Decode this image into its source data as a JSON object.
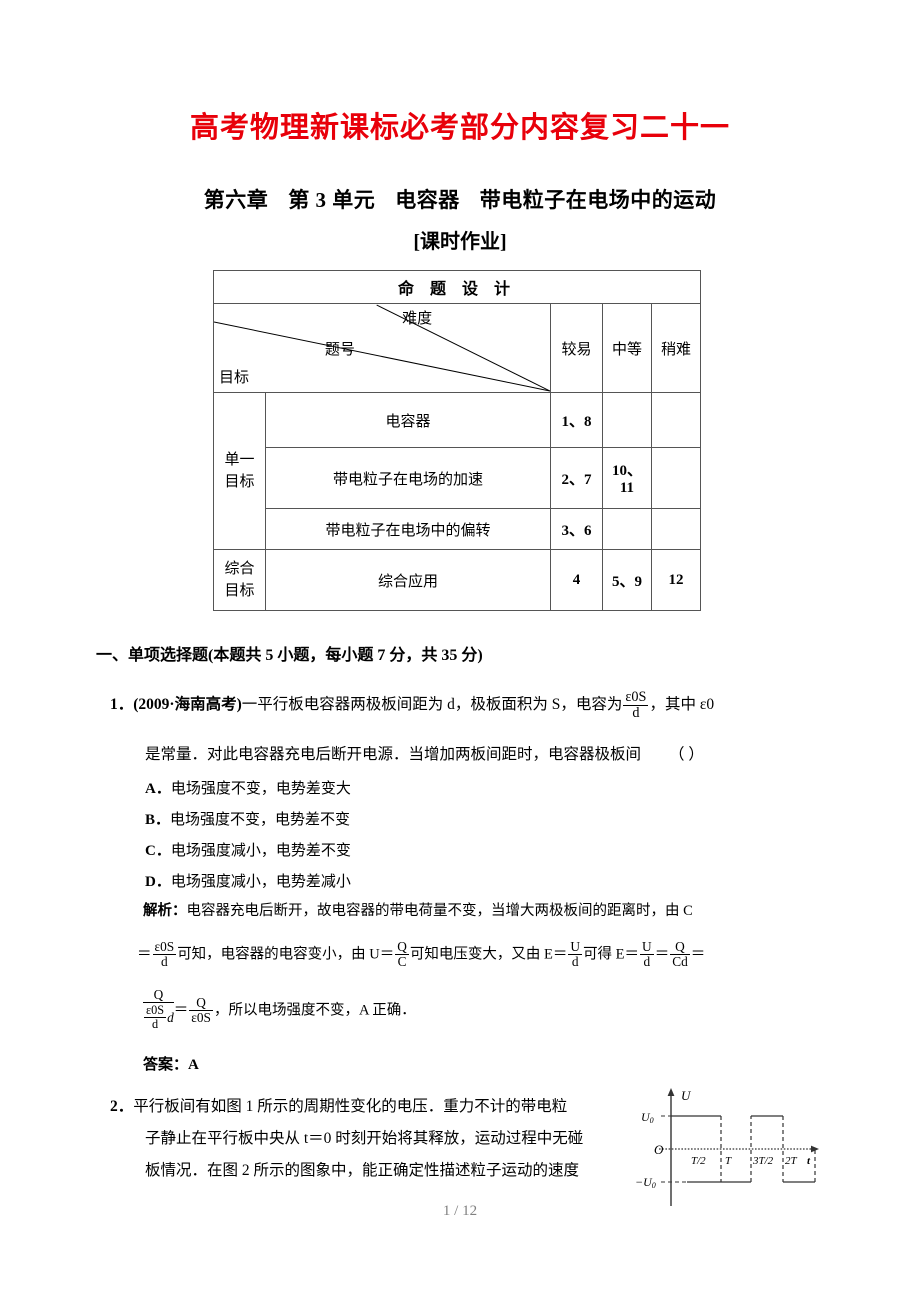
{
  "document": {
    "title": "高考物理新课标必考部分内容复习二十一",
    "title_color": "#e8000a",
    "subtitle_chapter": "第六章",
    "subtitle_unit": "第 3 单元",
    "subtitle_topic1": "电容器",
    "subtitle_topic2": "带电粒子在电场中的运动",
    "bracket_title": "[课时作业]",
    "page_number": "1 / 12"
  },
  "design_table": {
    "caption": "命 题 设 计",
    "header_difficulty": "难度",
    "header_question_no": "题号",
    "header_goal": "目标",
    "difficulty_columns": [
      "较易",
      "中等",
      "稍难"
    ],
    "groups": [
      {
        "label": "单一\n目标",
        "label_line1": "单一",
        "label_line2": "目标",
        "rows": [
          {
            "topic": "电容器",
            "easy": "1、8",
            "medium": "",
            "hard": ""
          },
          {
            "topic": "带电粒子在电场的加速",
            "easy": "2、7",
            "medium": "10、\n11",
            "medium_line1": "10、",
            "medium_line2": "11",
            "hard": ""
          },
          {
            "topic": "带电粒子在电场中的偏转",
            "easy": "3、6",
            "medium": "",
            "hard": ""
          }
        ]
      },
      {
        "label_line1": "综合",
        "label_line2": "目标",
        "rows": [
          {
            "topic": "综合应用",
            "easy": "4",
            "medium": "5、9",
            "hard": "12"
          }
        ]
      }
    ]
  },
  "section": {
    "heading_prefix": "一、单项选择题",
    "heading_detail": "(本题共 5 小题，每小题 7 分，共 35 分)"
  },
  "question1": {
    "number": "1．",
    "source": "(2009·海南高考)",
    "stem_part1": "一平行板电容器两极板间距为 d，极板面积为 S，电容为",
    "formula_numerator": "ε0S",
    "formula_denominator": "d",
    "stem_part2": "，其中 ε0",
    "line2": "是常量．对此电容器充电后断开电源．当增加两板间距时，电容器极板间",
    "answer_brackets": "（    ）",
    "options": [
      {
        "label": "A．",
        "text": "电场强度不变，电势差变大"
      },
      {
        "label": "B．",
        "text": "电场强度不变，电势差不变"
      },
      {
        "label": "C．",
        "text": "电场强度减小，电势差不变"
      },
      {
        "label": "D．",
        "text": "电场强度减小，电势差减小"
      }
    ],
    "solution_label": "解析：",
    "solution_line1": "电容器充电后断开，故电容器的带电荷量不变，当增大两极板间的距离时，由 C",
    "solution_line2_a": "＝",
    "solution_line2_b": "可知，电容器的电容变小，由 U＝",
    "solution_line2_c": "可知电压变大，又由 E＝",
    "solution_line2_d": "可得 E＝",
    "solution_line2_e": "＝",
    "solution_line3_a": "＝",
    "solution_line3_b": "，所以电场强度不变，A 正确．",
    "answer_label": "答案：",
    "answer_value": "A"
  },
  "question2": {
    "number": "2．",
    "line1": "平行板间有如图 1 所示的周期性变化的电压．重力不计的带电粒",
    "line2": "子静止在平行板中央从 t＝0 时刻开始将其释放，运动过程中无碰",
    "line3": "板情况．在图 2 所示的图象中，能正确定性描述粒子运动的速度"
  },
  "chart_data": {
    "type": "line",
    "title": "",
    "xlabel": "t",
    "ylabel": "U",
    "origin_label": "O",
    "y_tick_labels": [
      "U₀",
      "−U₀"
    ],
    "y_values": [
      1,
      -1
    ],
    "x_tick_labels": [
      "T/2",
      "T",
      "3T/2",
      "2T"
    ],
    "x_tick_values": [
      0.5,
      1.0,
      1.5,
      2.0
    ],
    "xlim": [
      0,
      2.25
    ],
    "ylim": [
      -1.45,
      1.45
    ],
    "grid": false,
    "legend": "none",
    "waveform": "square",
    "series": [
      {
        "name": "U(t)",
        "points": [
          {
            "x": 0.0,
            "y": 1
          },
          {
            "x": 0.5,
            "y": 1
          },
          {
            "x": 0.5,
            "y": -1
          },
          {
            "x": 1.0,
            "y": -1
          },
          {
            "x": 1.0,
            "y": 1
          },
          {
            "x": 1.5,
            "y": 1
          },
          {
            "x": 1.5,
            "y": -1
          },
          {
            "x": 2.0,
            "y": -1
          },
          {
            "x": 2.0,
            "y": 0
          }
        ]
      }
    ]
  }
}
